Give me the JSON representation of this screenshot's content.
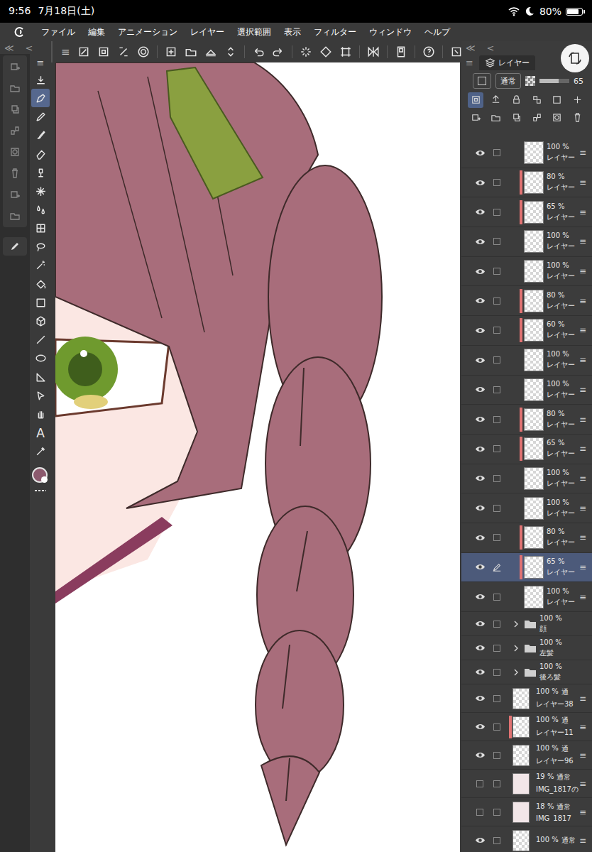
{
  "status_bar": {
    "time": "9:56",
    "date": "7月18日(土)",
    "battery": "80%",
    "battery_level": 0.8
  },
  "menu": [
    "ファイル",
    "編集",
    "アニメーション",
    "レイヤー",
    "選択範囲",
    "表示",
    "フィルター",
    "ウィンドウ",
    "ヘルプ"
  ],
  "glyphs": {
    "collapse_all": "≪",
    "collapse": "<",
    "menu": "≡"
  },
  "tools": [
    {
      "selected": false
    },
    {
      "selected": true
    },
    {
      "selected": false
    },
    {
      "selected": false
    },
    {
      "selected": false
    },
    {
      "selected": false
    },
    {
      "selected": false
    },
    {
      "selected": false
    },
    {
      "selected": false
    },
    {
      "selected": false
    },
    {
      "selected": false
    },
    {
      "selected": false
    },
    {
      "selected": false
    },
    {
      "selected": false
    },
    {
      "selected": false
    },
    {
      "selected": false
    },
    {
      "selected": false
    },
    {
      "selected": false
    },
    {
      "selected": false
    },
    {
      "selected": false,
      "glyph": "A"
    },
    {
      "selected": false
    }
  ],
  "layer_panel": {
    "tab": "レイヤー",
    "blend_mode": "通常",
    "opacity": "65",
    "opacity_level": 0.65,
    "layers": [
      {
        "kind": "layer",
        "opacity": "100 %",
        "name": "レイヤー",
        "visible": true,
        "clipped": false,
        "selected": false,
        "editing": false
      },
      {
        "kind": "layer",
        "opacity": "80 %",
        "name": "レイヤー",
        "visible": true,
        "clipped": true,
        "selected": false,
        "editing": false
      },
      {
        "kind": "layer",
        "opacity": "65 %",
        "name": "レイヤー",
        "visible": true,
        "clipped": true,
        "selected": false,
        "editing": false
      },
      {
        "kind": "layer",
        "opacity": "100 %",
        "name": "レイヤー",
        "visible": true,
        "clipped": false,
        "selected": false,
        "editing": false
      },
      {
        "kind": "layer",
        "opacity": "100 %",
        "name": "レイヤー",
        "visible": true,
        "clipped": false,
        "selected": false,
        "editing": false
      },
      {
        "kind": "layer",
        "opacity": "80 %",
        "name": "レイヤー",
        "visible": true,
        "clipped": true,
        "selected": false,
        "editing": false
      },
      {
        "kind": "layer",
        "opacity": "60 %",
        "name": "レイヤー",
        "visible": true,
        "clipped": true,
        "selected": false,
        "editing": false
      },
      {
        "kind": "layer",
        "opacity": "100 %",
        "name": "レイヤー",
        "visible": true,
        "clipped": false,
        "selected": false,
        "editing": false
      },
      {
        "kind": "layer",
        "opacity": "100 %",
        "name": "レイヤー",
        "visible": true,
        "clipped": false,
        "selected": false,
        "editing": false
      },
      {
        "kind": "layer",
        "opacity": "80 %",
        "name": "レイヤー",
        "visible": true,
        "clipped": true,
        "selected": false,
        "editing": false
      },
      {
        "kind": "layer",
        "opacity": "65 %",
        "name": "レイヤー",
        "visible": true,
        "clipped": true,
        "selected": false,
        "editing": false
      },
      {
        "kind": "layer",
        "opacity": "100 %",
        "name": "レイヤー",
        "visible": true,
        "clipped": false,
        "selected": false,
        "editing": false
      },
      {
        "kind": "layer",
        "opacity": "100 %",
        "name": "レイヤー",
        "visible": true,
        "clipped": false,
        "selected": false,
        "editing": false
      },
      {
        "kind": "layer",
        "opacity": "80 %",
        "name": "レイヤー",
        "visible": true,
        "clipped": true,
        "selected": false,
        "editing": false
      },
      {
        "kind": "layer",
        "opacity": "65 %",
        "name": "レイヤー",
        "visible": true,
        "clipped": true,
        "selected": true,
        "editing": true
      },
      {
        "kind": "layer",
        "opacity": "100 %",
        "name": "レイヤー",
        "visible": true,
        "clipped": false,
        "selected": false,
        "editing": false
      },
      {
        "kind": "folder",
        "opacity": "100 %",
        "name": "顔",
        "visible": true,
        "clipped": false,
        "selected": false,
        "editing": false
      },
      {
        "kind": "folder",
        "opacity": "100 %",
        "name": "左髪",
        "visible": true,
        "clipped": false,
        "selected": false,
        "editing": false
      },
      {
        "kind": "folder",
        "opacity": "100 %",
        "name": "後ろ髪",
        "visible": true,
        "clipped": false,
        "selected": false,
        "editing": false
      },
      {
        "kind": "detail",
        "opacity": "100 %",
        "mode": "通",
        "name": "レイヤー38",
        "visible": true,
        "clipped": false,
        "selected": false,
        "editing": false
      },
      {
        "kind": "detail",
        "opacity": "100 %",
        "mode": "通",
        "name": "レイヤー11",
        "visible": true,
        "clipped": true,
        "selected": false,
        "editing": false
      },
      {
        "kind": "detail",
        "opacity": "100 %",
        "mode": "通",
        "name": "レイヤー96",
        "visible": true,
        "clipped": false,
        "selected": false,
        "editing": false
      },
      {
        "kind": "image",
        "opacity": "19 %",
        "mode": "通常",
        "name": "IMG_1817の",
        "visible": false,
        "clipped": false,
        "selected": false,
        "editing": false
      },
      {
        "kind": "image",
        "opacity": "18 %",
        "mode": "通常",
        "name": "IMG_1817",
        "visible": false,
        "clipped": false,
        "selected": false,
        "editing": false
      },
      {
        "kind": "detail",
        "opacity": "100 %",
        "mode": "通常",
        "name": "",
        "visible": true,
        "clipped": false,
        "selected": false,
        "editing": false
      }
    ]
  }
}
